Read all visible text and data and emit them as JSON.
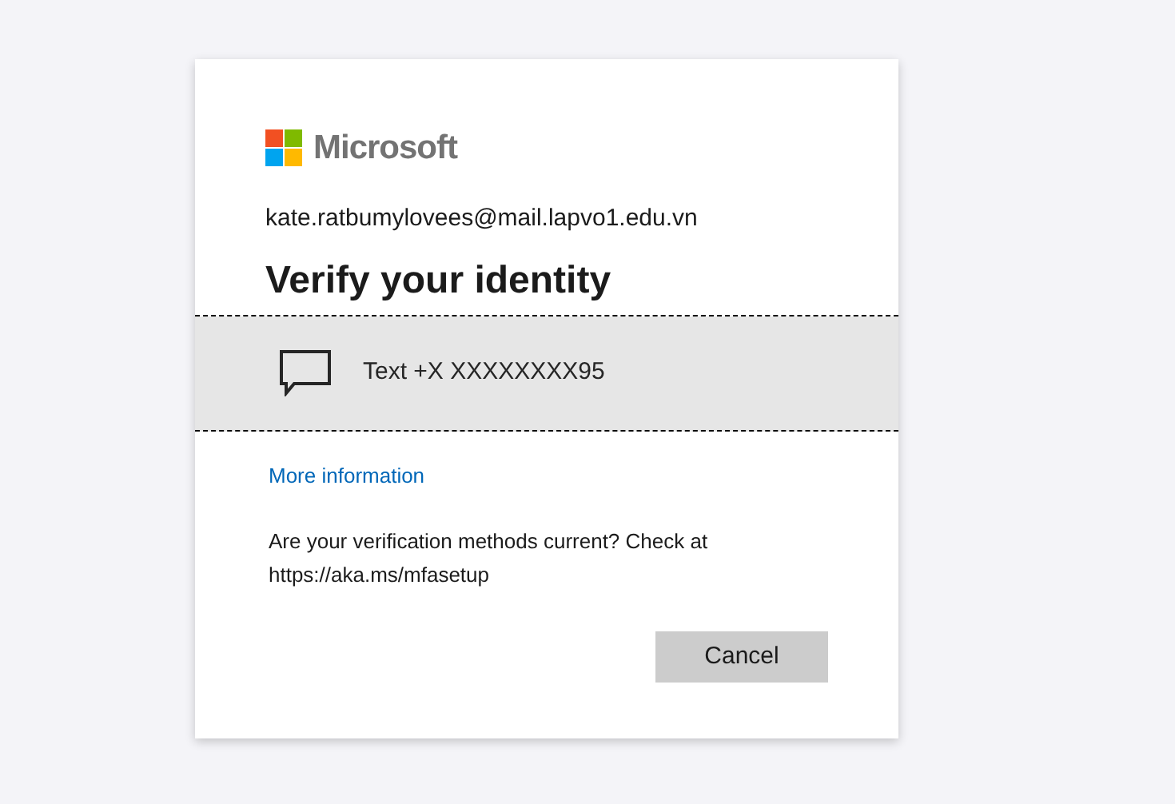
{
  "brand": {
    "name": "Microsoft"
  },
  "account": "kate.ratbumylovees@mail.lapvo1.edu.vn",
  "title": "Verify your identity",
  "methods": [
    {
      "kind": "text",
      "label": "Text +X XXXXXXXX95",
      "selected": true
    }
  ],
  "more_info_link": "More information",
  "notice": "Are your verification methods current? Check at https://aka.ms/mfasetup",
  "buttons": [
    "Cancel"
  ]
}
